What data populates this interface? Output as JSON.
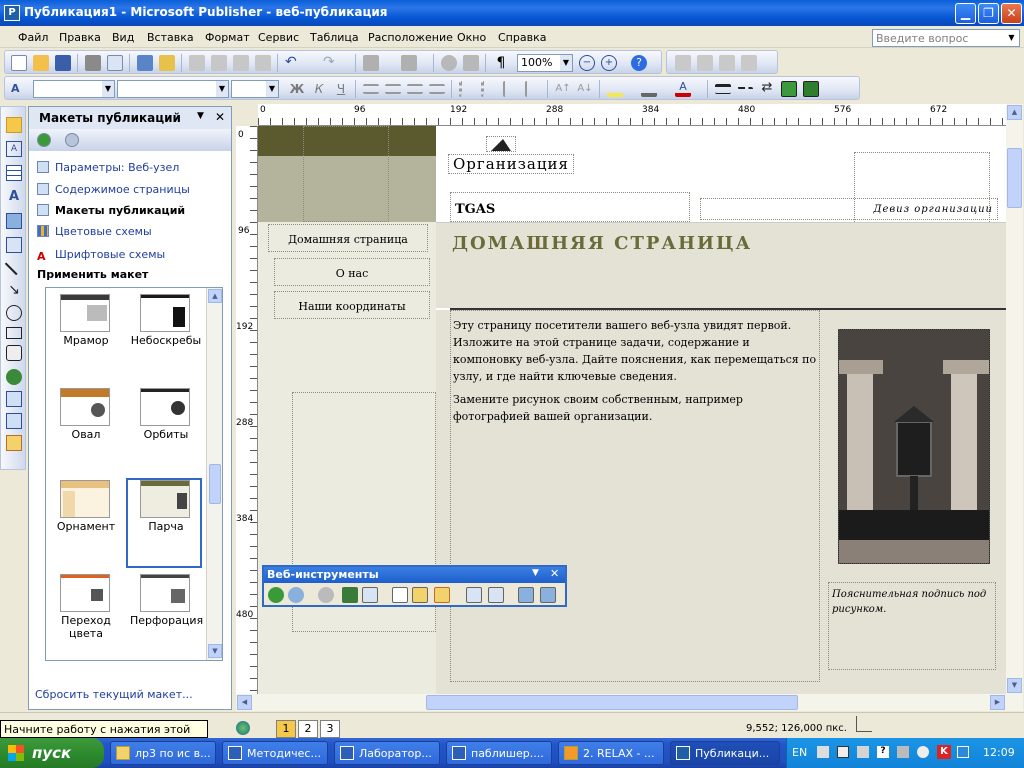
{
  "window": {
    "title": "Публикация1 - Microsoft Publisher - веб-публикация"
  },
  "menu": {
    "items": [
      "Файл",
      "Правка",
      "Вид",
      "Вставка",
      "Формат",
      "Сервис",
      "Таблица",
      "Расположение",
      "Окно",
      "Справка"
    ],
    "ask_placeholder": "Введите вопрос"
  },
  "toolbar": {
    "zoom": "100%"
  },
  "rulers": {
    "h_ticks": [
      "0",
      "96",
      "192",
      "288",
      "384",
      "480",
      "576",
      "672"
    ],
    "v_ticks": [
      "0",
      "96",
      "192",
      "288",
      "384",
      "480"
    ]
  },
  "taskpane": {
    "title": "Макеты публикаций",
    "links": [
      {
        "label": "Параметры: Веб-узел",
        "bold": false
      },
      {
        "label": "Содержимое страницы",
        "bold": false
      },
      {
        "label": "Макеты публикаций",
        "bold": true
      },
      {
        "label": "Цветовые схемы",
        "bold": false
      },
      {
        "label": "Шрифтовые схемы",
        "bold": false
      }
    ],
    "apply_heading": "Применить макет",
    "gallery": [
      {
        "label": "Мрамор",
        "color": "#3a3a3a"
      },
      {
        "label": "Небоскребы",
        "color": "#1a1a1a"
      },
      {
        "label": "Овал",
        "color": "#c07a2a"
      },
      {
        "label": "Орбиты",
        "color": "#222222"
      },
      {
        "label": "Орнамент",
        "color": "#e8c080"
      },
      {
        "label": "Парча",
        "color": "#6b6b3a"
      },
      {
        "label": "Переход цвета",
        "color": "#e06020"
      },
      {
        "label": "Перфорация",
        "color": "#444444"
      }
    ],
    "selected": "Парча",
    "reset_link": "Сбросить текущий макет..."
  },
  "page": {
    "org_name": "Организация",
    "company": "TGAS",
    "motto": "Девиз организации",
    "heading": "ДОМАШНЯЯ СТРАНИЦА",
    "nav": [
      "Домашняя страница",
      "О нас",
      "Наши координаты"
    ],
    "body1": "Эту страницу посетители вашего веб-узла увидят первой. Изложите на этой странице задачи, содержание и компоновку веб-узла. Дайте пояснения, как перемещаться по узлу, и где найти ключевые сведения.",
    "body2": "Замените рисунок своим собственным, например фотографией вашей организации.",
    "caption": "Пояснительная подпись под рисунком.",
    "accent_color": "#5a5a2e"
  },
  "webtools": {
    "title": "Веб-инструменты"
  },
  "statusbar": {
    "tooltip": "Начните работу с нажатия этой кнопки",
    "pages": [
      "1",
      "2",
      "3"
    ],
    "active_page": "1",
    "position": "9,552; 126,000 пкс."
  },
  "taskbar": {
    "start": "пуск",
    "buttons": [
      {
        "label": "лр3 по ис в...",
        "active": false
      },
      {
        "label": "Методичес...",
        "active": false
      },
      {
        "label": "Лаборатор...",
        "active": false
      },
      {
        "label": "паблишер....",
        "active": false
      },
      {
        "label": "2. RELAX - ...",
        "active": false
      },
      {
        "label": "Публикаци...",
        "active": true
      }
    ],
    "lang": "EN",
    "clock": "12:09"
  }
}
